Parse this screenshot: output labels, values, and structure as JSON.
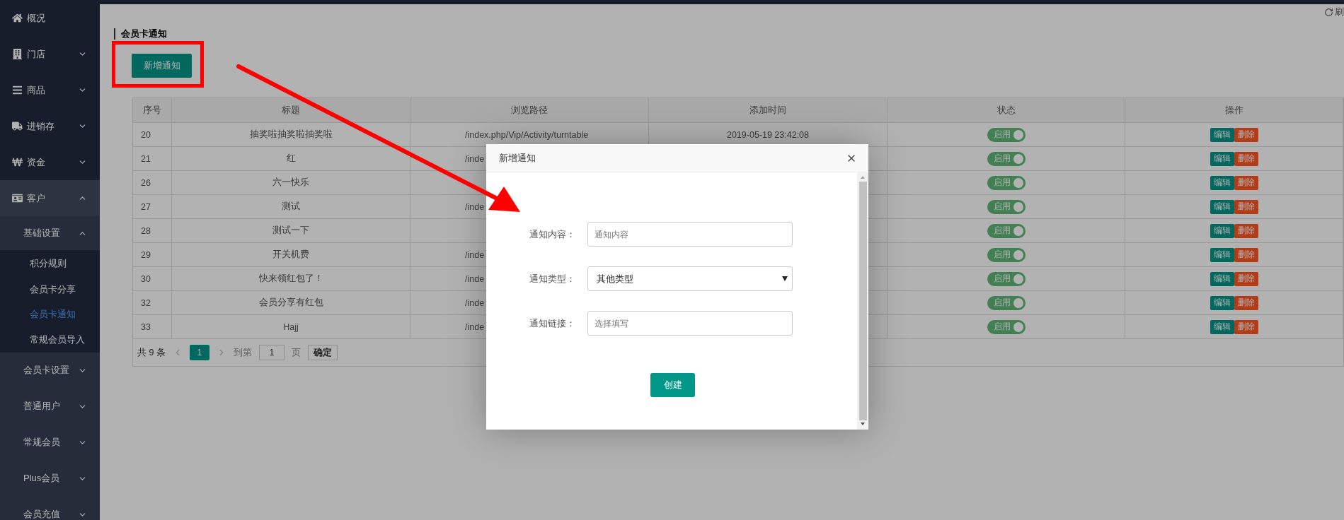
{
  "sidebar": {
    "items": [
      {
        "label": "概况"
      },
      {
        "label": "门店",
        "expanded": false
      },
      {
        "label": "商品",
        "expanded": false
      },
      {
        "label": "进销存",
        "expanded": false
      },
      {
        "label": "资金",
        "expanded": false
      },
      {
        "label": "客户",
        "expanded": true,
        "children": [
          {
            "label": "基础设置",
            "expanded": true,
            "children": [
              {
                "label": "积分规则",
                "selected": false
              },
              {
                "label": "会员卡分享",
                "selected": false
              },
              {
                "label": "会员卡通知",
                "selected": true
              },
              {
                "label": "常规会员导入",
                "selected": false
              }
            ]
          },
          {
            "label": "会员卡设置",
            "expanded": false
          },
          {
            "label": "普通用户",
            "expanded": false
          },
          {
            "label": "常规会员",
            "expanded": false
          },
          {
            "label": "Plus会员",
            "expanded": false
          },
          {
            "label": "会员充值",
            "expanded": false
          }
        ]
      }
    ]
  },
  "toolbar": {
    "refresh": "刷"
  },
  "page_title": "会员卡通知",
  "add_button": "新增通知",
  "table": {
    "columns": [
      "序号",
      "标题",
      "浏览路径",
      "添加时间",
      "状态",
      "操作"
    ],
    "rows": [
      {
        "id": "20",
        "title": "抽奖啦抽奖啦抽奖啦",
        "path": "/index.php/Vip/Activity/turntable",
        "time": "2019-05-19 23:42:08",
        "status": {
          "label": "启用",
          "on": true
        },
        "actions": [
          "编辑",
          "删除"
        ]
      },
      {
        "id": "21",
        "title": "红",
        "path": "/inde",
        "status": {
          "label": "启用",
          "on": true
        },
        "actions": [
          "编辑",
          "删除"
        ]
      },
      {
        "id": "26",
        "title": "六一快乐",
        "status": {
          "label": "启用",
          "on": true
        },
        "actions": [
          "编辑",
          "删除"
        ]
      },
      {
        "id": "27",
        "title": "测试",
        "path": "/inde",
        "status": {
          "label": "启用",
          "on": true
        },
        "actions": [
          "编辑",
          "删除"
        ]
      },
      {
        "id": "28",
        "title": "测试一下",
        "status": {
          "label": "启用",
          "on": true
        },
        "actions": [
          "编辑",
          "删除"
        ]
      },
      {
        "id": "29",
        "title": "开关机费",
        "path": "/inde",
        "status": {
          "label": "启用",
          "on": true
        },
        "actions": [
          "编辑",
          "删除"
        ]
      },
      {
        "id": "30",
        "title": "快来领红包了！",
        "path": "/inde",
        "status": {
          "label": "启用",
          "on": true
        },
        "actions": [
          "编辑",
          "删除"
        ]
      },
      {
        "id": "32",
        "title": "会员分享有红包",
        "path": "/inde",
        "status": {
          "label": "启用",
          "on": true
        },
        "actions": [
          "编辑",
          "删除"
        ]
      },
      {
        "id": "33",
        "title": "Hajj",
        "path": "/inde",
        "status": {
          "label": "启用",
          "on": true
        },
        "actions": [
          "编辑",
          "删除"
        ]
      }
    ]
  },
  "pagination": {
    "total": "共 9 条",
    "current": "1",
    "goto_label": "到第",
    "page_input": "1",
    "page_unit": "页",
    "confirm": "确定"
  },
  "dialog": {
    "title": "新增通知",
    "fields": [
      {
        "kind": "input",
        "label": "通知内容：",
        "placeholder": "通知内容"
      },
      {
        "kind": "select",
        "label": "通知类型：",
        "value": "其他类型"
      },
      {
        "kind": "input",
        "label": "通知链接：",
        "placeholder": "选择填写"
      }
    ],
    "submit": "创建"
  }
}
